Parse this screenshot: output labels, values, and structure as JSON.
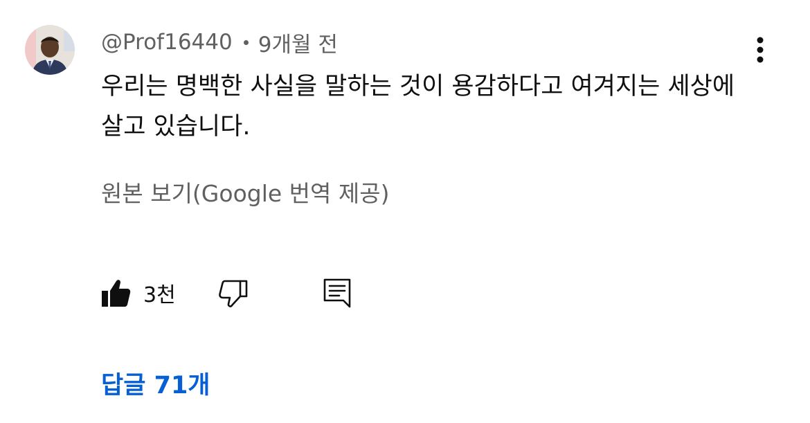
{
  "comment": {
    "author": "@Prof16440",
    "time": "9개월 전",
    "text": "우리는 명백한 사실을 말하는 것이 용감하다고 여겨지는 세상에 살고 있습니다.",
    "see_original": "원본 보기(Google 번역 제공)"
  },
  "actions": {
    "like_count": "3천"
  },
  "replies": {
    "label": "답글 71개"
  },
  "colors": {
    "primary_text": "#0f0f0f",
    "secondary_text": "#606060",
    "link_blue": "#065fd4"
  },
  "icons": {
    "avatar": "user-avatar",
    "more": "more-vertical-icon",
    "like": "thumbs-up-filled-icon",
    "dislike": "thumbs-down-outline-icon",
    "reply": "comment-reply-icon"
  }
}
